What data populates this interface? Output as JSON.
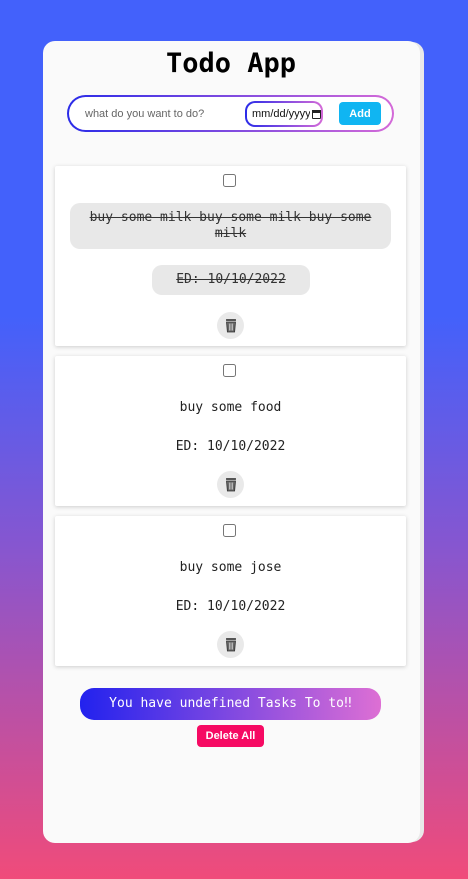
{
  "app": {
    "title": "Todo App"
  },
  "form": {
    "task_placeholder": "what do you want to do?",
    "date_placeholder": "mm/dd/yyyy",
    "add_label": "Add"
  },
  "tasks": [
    {
      "text": "buy some milk buy some milk buy some milk",
      "date_label": "ED: 10/10/2022",
      "completed": true,
      "delete_icon": "trash-icon"
    },
    {
      "text": "buy some food",
      "date_label": "ED: 10/10/2022",
      "completed": false,
      "delete_icon": "trash-icon"
    },
    {
      "text": "buy some jose",
      "date_label": "ED: 10/10/2022",
      "completed": false,
      "delete_icon": "trash-icon"
    }
  ],
  "footer": {
    "counter_text": "You have undefined Tasks To to‼",
    "delete_all_label": "Delete All"
  },
  "colors": {
    "background_top": "#4361fb",
    "background_bottom": "#f04b7a",
    "add_button": "#10b5f2",
    "delete_all_button": "#f60a63",
    "gradient_start": "#2222ee",
    "gradient_end": "#dd6fd4"
  }
}
